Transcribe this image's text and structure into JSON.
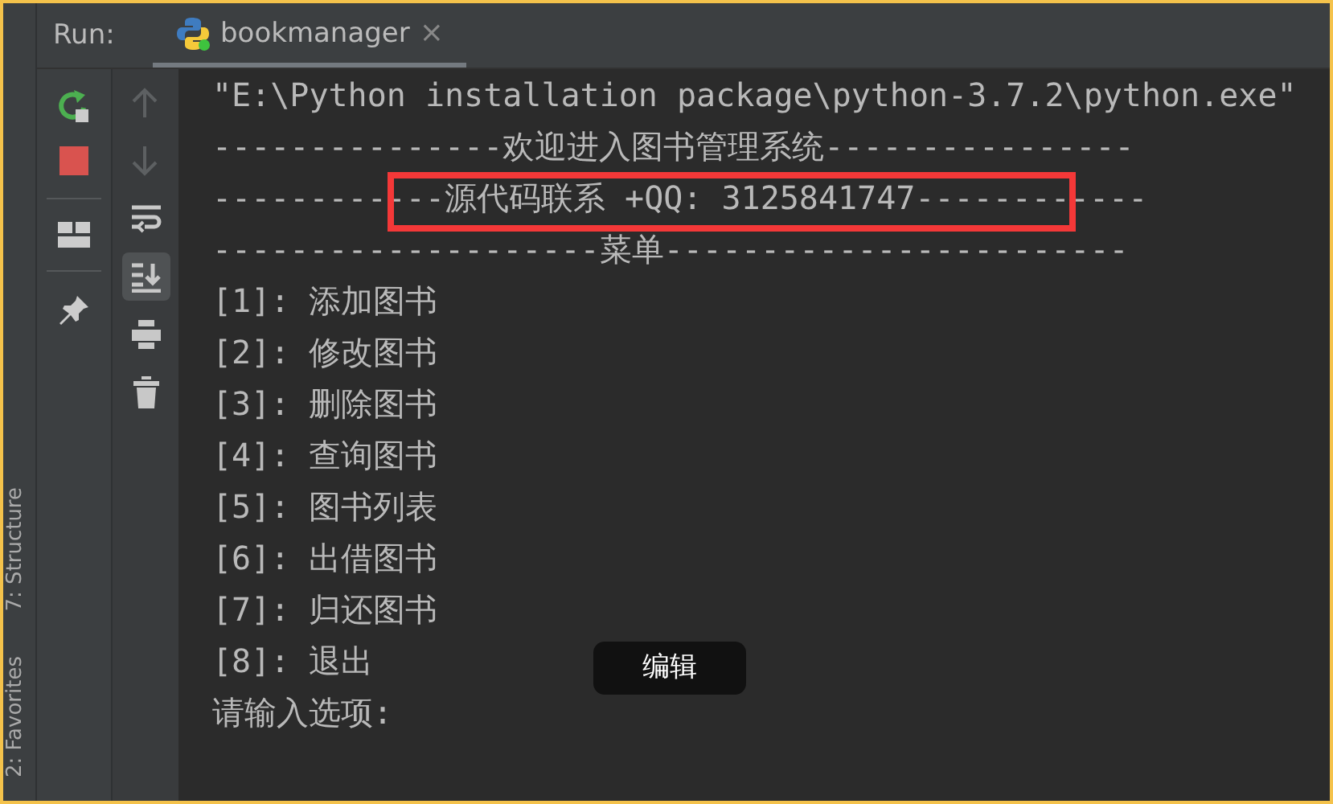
{
  "run_label": "Run:",
  "tab": {
    "title": "bookmanager",
    "selected": true,
    "close": "×"
  },
  "tool_windows": [
    "7: Structure",
    "2: Favorites"
  ],
  "left_toolbar": [
    {
      "kind": "rerun"
    },
    {
      "kind": "stop"
    },
    {
      "kind": "layout"
    },
    {
      "kind": "pin"
    }
  ],
  "side_toolbar": [
    {
      "kind": "up",
      "disabled": true,
      "selected": false
    },
    {
      "kind": "down",
      "disabled": true,
      "selected": false
    },
    {
      "kind": "wrap",
      "disabled": false,
      "selected": false
    },
    {
      "kind": "scroll-end",
      "disabled": false,
      "selected": true
    },
    {
      "kind": "print",
      "disabled": false,
      "selected": false
    },
    {
      "kind": "trash",
      "disabled": false,
      "selected": false
    }
  ],
  "console_lines": [
    {
      "text": "\"E:\\Python installation package\\python-3.7.2\\python.exe\"",
      "highlighted": false
    },
    {
      "text": "---------------欢迎进入图书管理系统----------------",
      "highlighted": false
    },
    {
      "text": "------------源代码联系 +QQ: 3125841747------------",
      "highlighted": true
    },
    {
      "text": "--------------------菜单------------------------",
      "highlighted": false
    },
    {
      "text": "[1]: 添加图书",
      "highlighted": false
    },
    {
      "text": "[2]: 修改图书",
      "highlighted": false
    },
    {
      "text": "[3]: 删除图书",
      "highlighted": false
    },
    {
      "text": "[4]: 查询图书",
      "highlighted": false
    },
    {
      "text": "[5]: 图书列表",
      "highlighted": false
    },
    {
      "text": "[6]: 出借图书",
      "highlighted": false
    },
    {
      "text": "[7]: 归还图书",
      "highlighted": false
    },
    {
      "text": "[8]: 退出",
      "highlighted": false
    },
    {
      "text": "请输入选项:",
      "highlighted": false
    }
  ],
  "edit_badge": "编辑"
}
